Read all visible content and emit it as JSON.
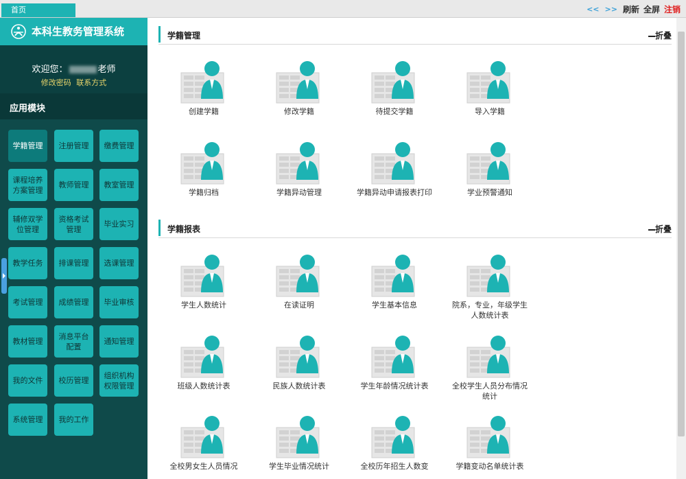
{
  "topbar": {
    "tab_home": "首页",
    "nav_prev": "<<",
    "nav_next": ">>",
    "refresh": "刷新",
    "fullscreen": "全屏",
    "logout": "注销"
  },
  "sidebar": {
    "brand_title": "本科生教务管理系统",
    "welcome_prefix": "欢迎您：",
    "welcome_suffix": "老师",
    "link_change_password": "修改密码",
    "link_contact": "联系方式",
    "module_title": "应用模块",
    "modules": [
      "学籍管理",
      "注册管理",
      "缴费管理",
      "课程培养方案管理",
      "教师管理",
      "教室管理",
      "辅修双学位管理",
      "资格考试管理",
      "毕业实习",
      "教学任务",
      "排课管理",
      "选课管理",
      "考试管理",
      "成绩管理",
      "毕业审核",
      "教材管理",
      "消息平台配置",
      "通知管理",
      "我的文件",
      "校历管理",
      "组织机构权限管理",
      "系统管理",
      "我的工作"
    ]
  },
  "sections": [
    {
      "title": "学籍管理",
      "fold": "折叠",
      "items": [
        "创建学籍",
        "修改学籍",
        "待提交学籍",
        "导入学籍",
        "学籍归档",
        "学籍异动管理",
        "学籍异动申请报表打印",
        "学业预警通知"
      ]
    },
    {
      "title": "学籍报表",
      "fold": "折叠",
      "items": [
        "学生人数统计",
        "在读证明",
        "学生基本信息",
        "院系，专业，年级学生人数统计表",
        "班级人数统计表",
        "民族人数统计表",
        "学生年龄情况统计表",
        "全校学生人员分布情况统计",
        "全校男女生人员情况",
        "学生毕业情况统计",
        "全校历年招生人数变",
        "学籍变动名单统计表"
      ]
    }
  ],
  "colors": {
    "accent": "#1db3b3",
    "sidebar_bg": "#0f4a4a",
    "logout": "#e02020"
  }
}
